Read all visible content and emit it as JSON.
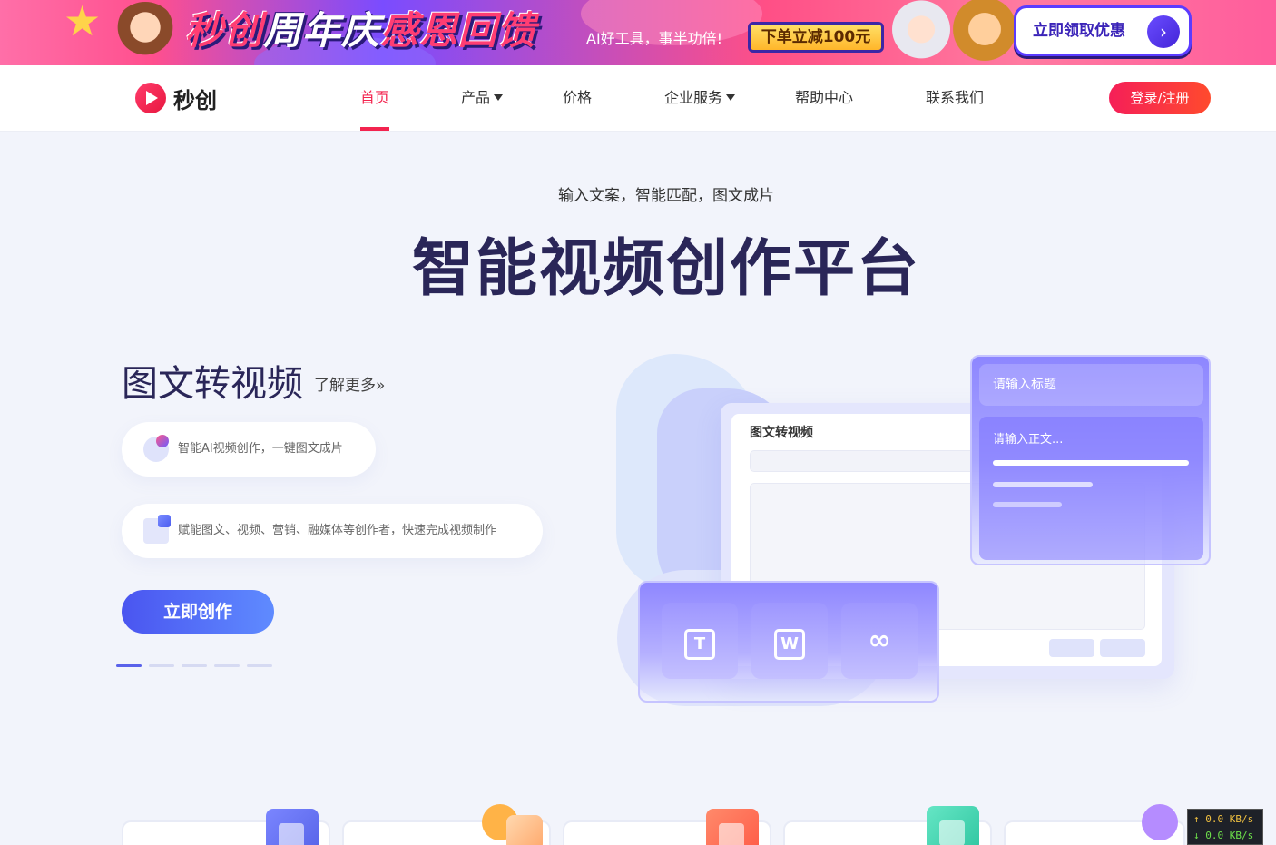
{
  "banner": {
    "title_part1": "秒创",
    "title_part2": "周年庆",
    "title_part3": "感恩回馈",
    "subtitle": "AI好工具，事半功倍!",
    "coupon": "下单立减100元",
    "cta": "立即领取优惠",
    "cta_icon": "chevron-right-icon",
    "colors": {
      "brand_purple": "#5b3bff",
      "coupon_yellow": "#ffd34a",
      "banner_pink": "#ff4f8e"
    }
  },
  "nav": {
    "logo_text": "秒创",
    "items": [
      {
        "label": "首页",
        "active": true
      },
      {
        "label": "产品",
        "dropdown": true
      },
      {
        "label": "价格"
      },
      {
        "label": "企业服务",
        "dropdown": true
      },
      {
        "label": "帮助中心"
      },
      {
        "label": "联系我们"
      }
    ],
    "login": "登录/注册",
    "colors": {
      "accent": "#f3244f"
    }
  },
  "hero": {
    "subtitle": "输入文案，智能匹配，图文成片",
    "title": "智能视频创作平台"
  },
  "feature": {
    "title": "图文转视频",
    "more": "了解更多»",
    "points": [
      {
        "icon": "ai-sparkle-icon",
        "text": "智能AI视频创作，一键图文成片"
      },
      {
        "icon": "share-upload-icon",
        "text": "赋能图文、视频、营销、融媒体等创作者，快速完成视频制作"
      }
    ],
    "button": "立即创作",
    "carousel": {
      "count": 5,
      "active": 1
    },
    "colors": {
      "button_start": "#4a55f0",
      "button_end": "#5f8bff"
    }
  },
  "illustration": {
    "card_label": "图文转视频",
    "panel_title_placeholder": "请输入标题",
    "panel_body_placeholder": "请输入正文...",
    "tiles": [
      {
        "icon": "text-icon",
        "glyph": "T"
      },
      {
        "icon": "word-doc-icon",
        "glyph": "W"
      },
      {
        "icon": "link-icon",
        "glyph": "∞"
      }
    ]
  },
  "bottom_cards": [
    {
      "icon": "image-icon",
      "color": "#6b77f0"
    },
    {
      "icon": "voice-icon",
      "color": "#ffb36a"
    },
    {
      "icon": "video-icon",
      "color": "#ff6b55"
    },
    {
      "icon": "pen-icon",
      "color": "#43d6b4"
    },
    {
      "icon": "palette-icon",
      "color": "#a07bff"
    }
  ],
  "netspeed": {
    "up": "↑ 0.0 KB/s",
    "down": "↓ 0.0 KB/s"
  }
}
